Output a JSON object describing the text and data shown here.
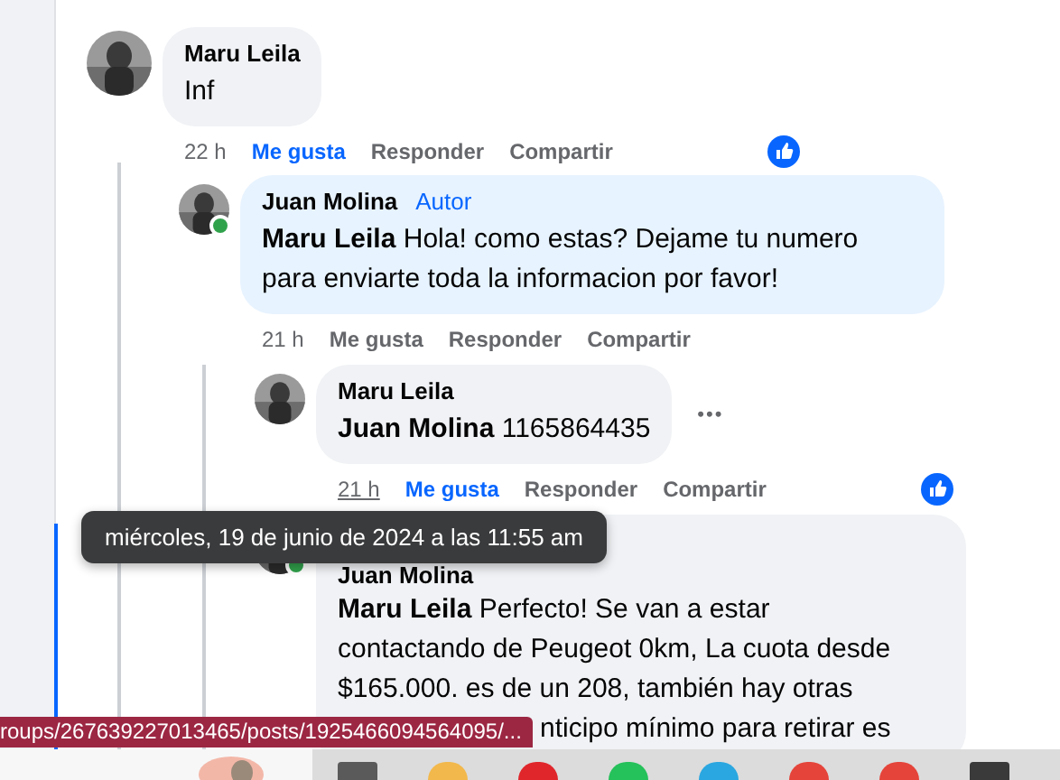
{
  "comments": [
    {
      "author": "Maru Leila",
      "text": "Inf",
      "online": false,
      "time": "22 h",
      "time_hovered": false,
      "liked": true,
      "actions": [
        "Me gusta",
        "Responder",
        "Compartir"
      ],
      "children": [
        {
          "author": "Juan Molina",
          "author_badge": "Autor",
          "mention": "Maru Leila",
          "text": "Hola! como estas? Dejame tu numero para enviarte toda la informacion por favor!",
          "online": true,
          "time": "21 h",
          "time_hovered": false,
          "liked": false,
          "actions": [
            "Me gusta",
            "Responder",
            "Compartir"
          ],
          "children": [
            {
              "author": "Maru Leila",
              "mention": "Juan Molina",
              "text": "1165864435",
              "online": false,
              "time": "21 h",
              "time_hovered": true,
              "liked": true,
              "actions": [
                "Me gusta",
                "Responder",
                "Compartir"
              ],
              "more": "•••"
            },
            {
              "author": "Juan Molina",
              "mention": "Maru Leila",
              "text": "Perfecto! Se van a estar contactando de Peugeot 0km, La cuota desde $165.000. es de un 208, también hay otras",
              "online": true,
              "extra_line": "nticipo mínimo para retirar es"
            }
          ]
        }
      ]
    }
  ],
  "tooltip": "miércoles, 19 de junio de 2024 a las 11:55 am",
  "status_url": "roups/267639227013465/posts/1925466094564095/...",
  "taskbar": {
    "apps": [
      {
        "color": "#5a5a5a"
      },
      {
        "color": "#f2b84b"
      },
      {
        "color": "#e0262b"
      },
      {
        "color": "#25c15a"
      },
      {
        "color": "#2aa7e0"
      },
      {
        "color": "#e5443a"
      },
      {
        "color": "#e5443a"
      },
      {
        "color": "#3a3a3a"
      }
    ]
  }
}
